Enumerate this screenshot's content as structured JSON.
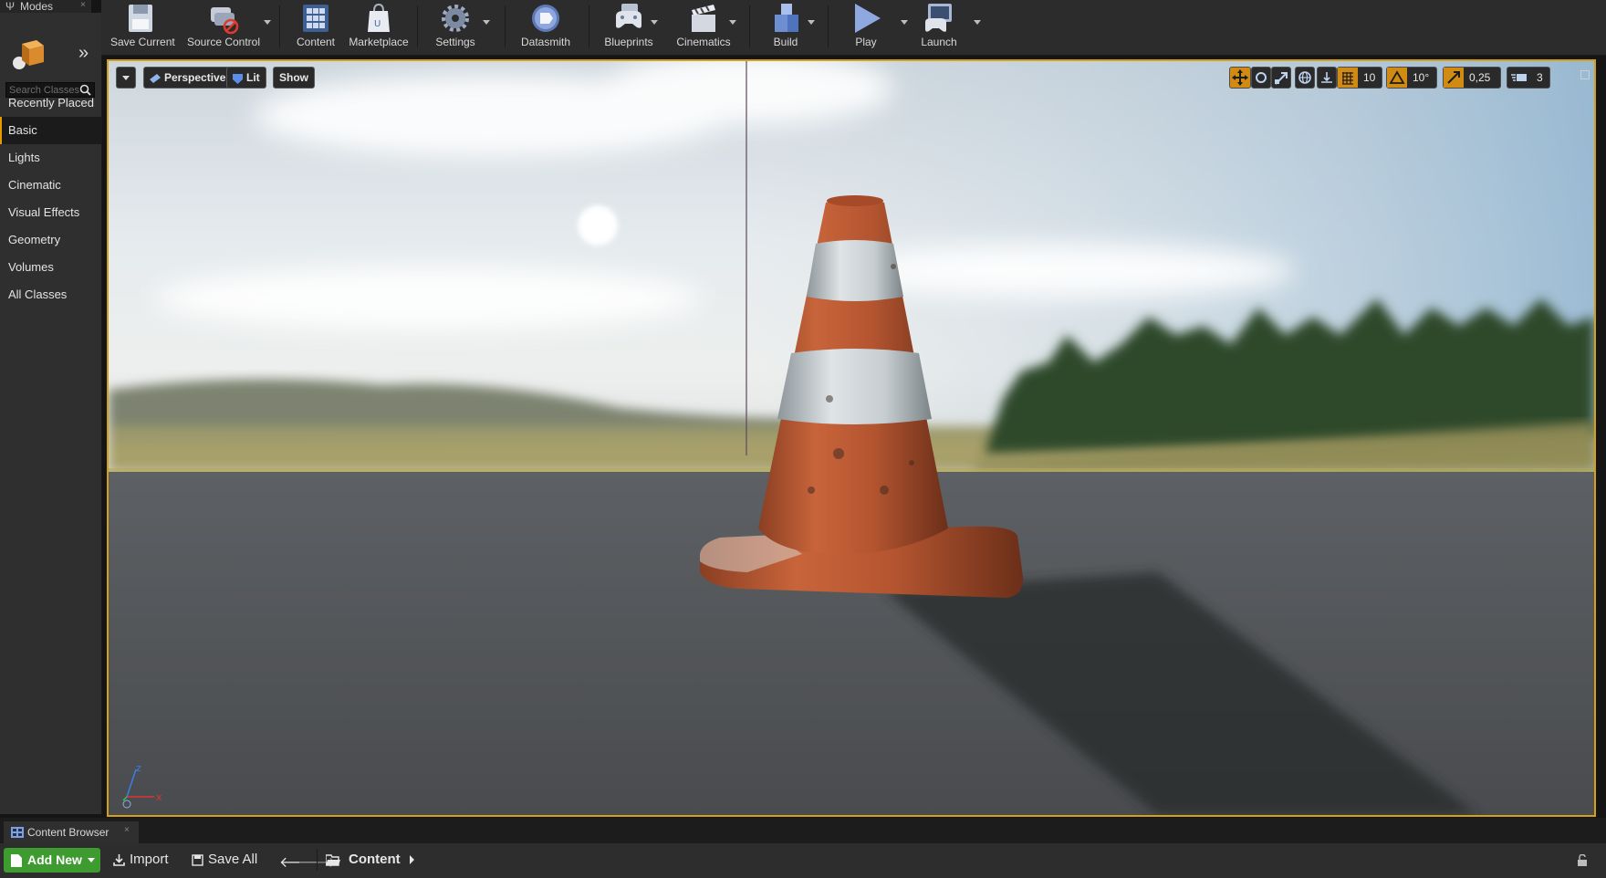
{
  "modes": {
    "tab_label": "Modes",
    "search_placeholder": "Search Classes",
    "categories": [
      "Recently Placed",
      "Basic",
      "Lights",
      "Cinematic",
      "Visual Effects",
      "Geometry",
      "Volumes",
      "All Classes"
    ],
    "selected_category": "Basic"
  },
  "toolbar": {
    "save_current": "Save Current",
    "source_control": "Source Control",
    "content": "Content",
    "marketplace": "Marketplace",
    "settings": "Settings",
    "datasmith": "Datasmith",
    "blueprints": "Blueprints",
    "cinematics": "Cinematics",
    "build": "Build",
    "play": "Play",
    "launch": "Launch"
  },
  "viewport": {
    "perspective_label": "Perspective",
    "lit_label": "Lit",
    "show_label": "Show",
    "grid_snap_value": "10",
    "rotation_snap_value": "10°",
    "scale_snap_value": "0,25",
    "camera_speed_value": "3",
    "axis_x_label": "x",
    "axis_z_label": "z"
  },
  "content_browser": {
    "tab_label": "Content Browser",
    "add_new_label": "Add New",
    "import_label": "Import",
    "save_all_label": "Save All",
    "path_label": "Content"
  },
  "colors": {
    "accent_orange": "#d4a017",
    "add_new_green": "#3d9b2f",
    "panel_bg": "#2f2f2f",
    "selected_bar": "#e59a00"
  }
}
